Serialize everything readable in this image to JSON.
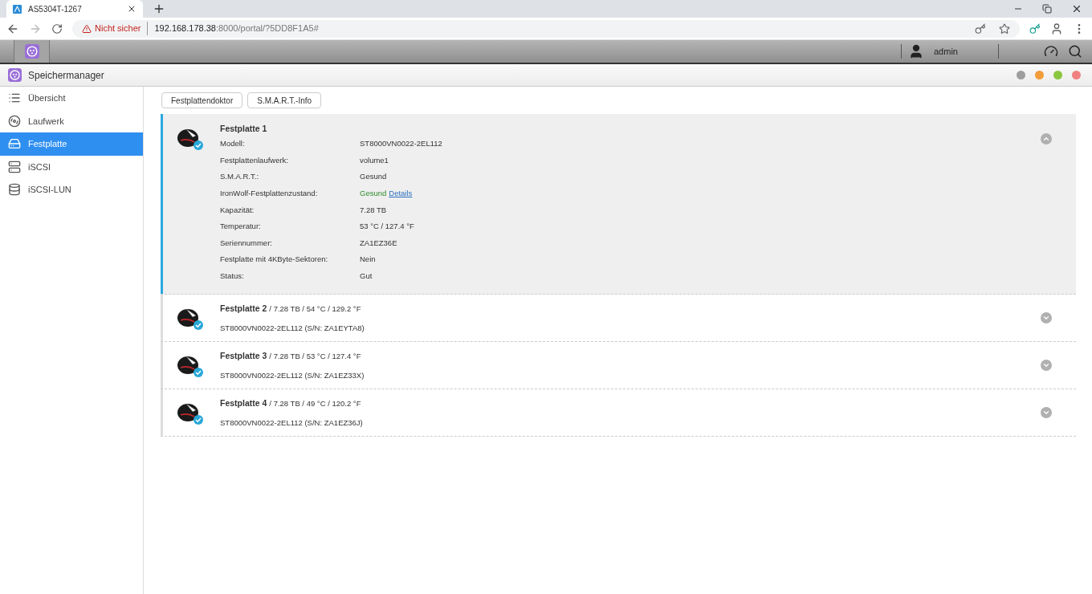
{
  "browser": {
    "tab_title": "AS5304T-1267",
    "warning": "Nicht sicher",
    "url_host": "192.168.178.38",
    "url_rest": ":8000/portal/?5DD8F1A5#"
  },
  "topbar": {
    "user": "admin"
  },
  "app": {
    "title": "Speichermanager",
    "window_dots": [
      {
        "color": "#9e9e9e"
      },
      {
        "color": "#f39c3a"
      },
      {
        "color": "#8cc63f"
      },
      {
        "color": "#f08080"
      }
    ]
  },
  "sidebar": {
    "items": [
      {
        "label": "Übersicht",
        "kind": "list",
        "selected": false
      },
      {
        "label": "Laufwerk",
        "kind": "volume",
        "selected": false
      },
      {
        "label": "Festplatte",
        "kind": "disk",
        "selected": true
      },
      {
        "label": "iSCSI",
        "kind": "iscsi",
        "selected": false
      },
      {
        "label": "iSCSI-LUN",
        "kind": "lun",
        "selected": false
      }
    ]
  },
  "toolbar": [
    "Festplattendoktor",
    "S.M.A.R.T.-Info"
  ],
  "disks": [
    {
      "title": "Festplatte 1",
      "expanded": true,
      "details": [
        {
          "kind": "text",
          "label": "Modell:",
          "value": "ST8000VN0022-2EL112"
        },
        {
          "kind": "text",
          "label": "Festplattenlaufwerk:",
          "value": "volume1"
        },
        {
          "kind": "text",
          "label": "S.M.A.R.T.:",
          "value": "Gesund"
        },
        {
          "kind": "status_link",
          "label": "IronWolf-Festplattenzustand:",
          "value": "Gesund",
          "link": "Details"
        },
        {
          "kind": "text",
          "label": "Kapazität:",
          "value": "7.28 TB"
        },
        {
          "kind": "text",
          "label": "Temperatur:",
          "value": "53 °C / 127.4 °F"
        },
        {
          "kind": "text",
          "label": "Seriennummer:",
          "value": "ZA1EZ36E"
        },
        {
          "kind": "text",
          "label": "Festplatte mit 4KByte-Sektoren:",
          "value": "Nein"
        },
        {
          "kind": "text",
          "label": "Status:",
          "value": "Gut"
        }
      ]
    },
    {
      "title": "Festplatte 2",
      "expanded": false,
      "summary": "/ 7.28 TB / 54 °C / 129.2 °F",
      "subtitle": "ST8000VN0022-2EL112 (S/N: ZA1EYTA8)"
    },
    {
      "title": "Festplatte 3",
      "expanded": false,
      "summary": "/ 7.28 TB / 53 °C / 127.4 °F",
      "subtitle": "ST8000VN0022-2EL112 (S/N: ZA1EZ33X)"
    },
    {
      "title": "Festplatte 4",
      "expanded": false,
      "summary": "/ 7.28 TB / 49 °C / 120.2 °F",
      "subtitle": "ST8000VN0022-2EL112 (S/N: ZA1EZ36J)"
    }
  ]
}
